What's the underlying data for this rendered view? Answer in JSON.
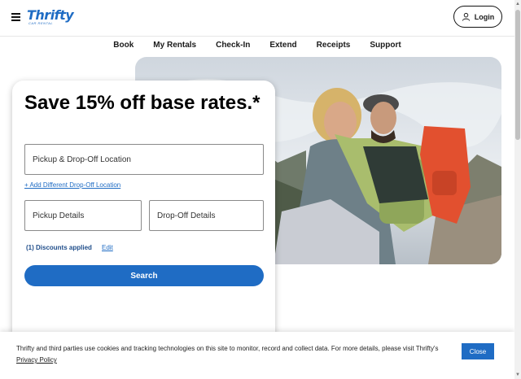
{
  "header": {
    "logo_text": "Thrifty",
    "logo_sub": "CAR RENTAL",
    "login_label": "Login"
  },
  "nav": {
    "items": [
      "Book",
      "My Rentals",
      "Check-In",
      "Extend",
      "Receipts",
      "Support"
    ]
  },
  "booking": {
    "headline": "Save 15% off base rates.*",
    "location_placeholder": "Pickup & Drop-Off Location",
    "add_dropoff_link": "+ Add Different Drop-Off Location",
    "pickup_placeholder": "Pickup Details",
    "dropoff_placeholder": "Drop-Off Details",
    "discounts": "(1) Discounts applied",
    "edit_label": "Edit",
    "search_label": "Search"
  },
  "cookie": {
    "text": "Thrifty and third parties use cookies and tracking technologies on this site to monitor, record and collect data. For more details, please visit Thrifty's",
    "policy_link": "Privacy Policy",
    "close_label": "Close"
  },
  "colors": {
    "brand_blue": "#1f6cc4"
  },
  "icons": {
    "menu": "hamburger-icon",
    "login": "user-icon"
  }
}
